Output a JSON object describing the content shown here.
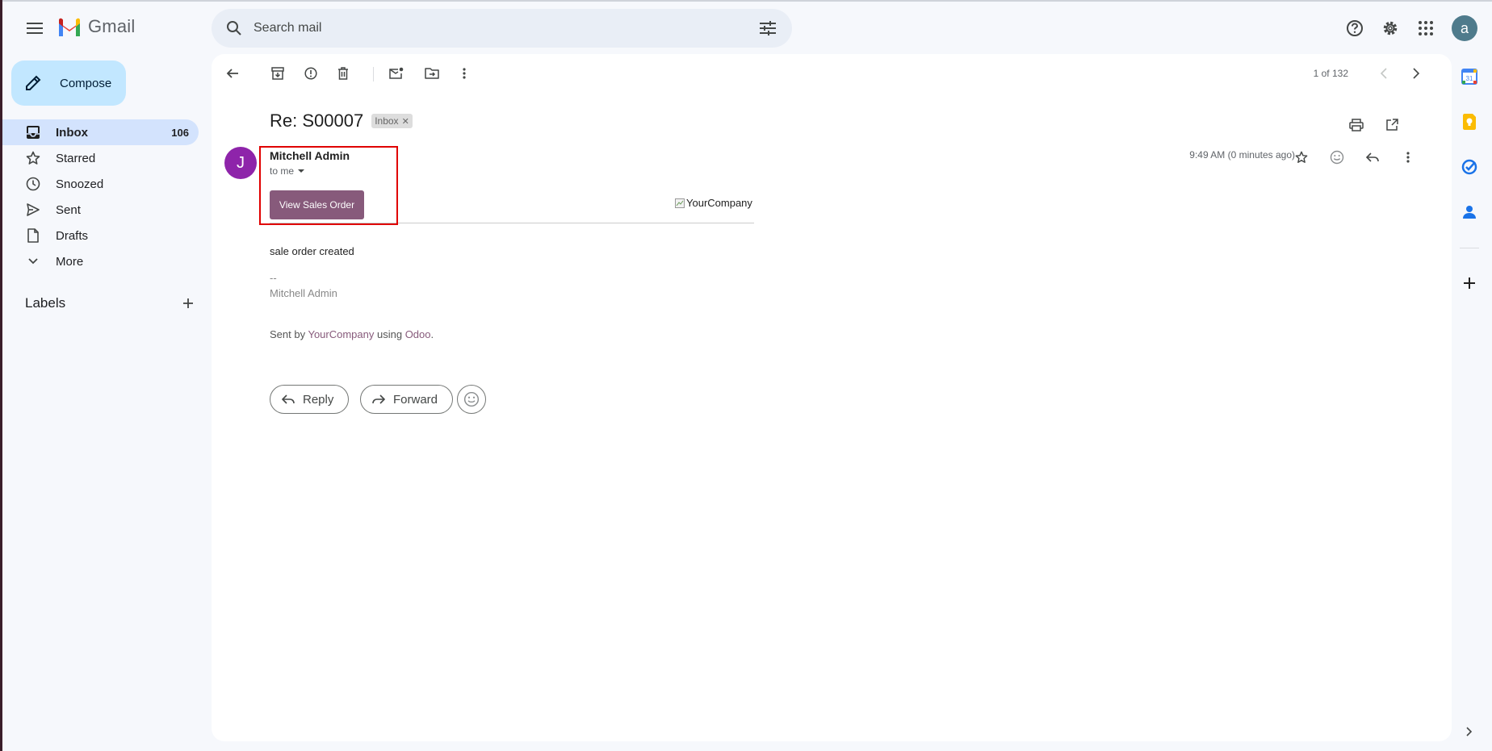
{
  "app": {
    "name": "Gmail"
  },
  "search": {
    "placeholder": "Search mail"
  },
  "account": {
    "initial": "a"
  },
  "compose": {
    "label": "Compose"
  },
  "nav": {
    "items": [
      {
        "label": "Inbox",
        "count": "106",
        "icon": "inbox-icon"
      },
      {
        "label": "Starred",
        "count": "",
        "icon": "star-icon"
      },
      {
        "label": "Snoozed",
        "count": "",
        "icon": "clock-icon"
      },
      {
        "label": "Sent",
        "count": "",
        "icon": "send-icon"
      },
      {
        "label": "Drafts",
        "count": "",
        "icon": "draft-icon"
      },
      {
        "label": "More",
        "count": "",
        "icon": "chevron-down-icon"
      }
    ],
    "labels_heading": "Labels"
  },
  "toolbar": {
    "pager": "1 of 132"
  },
  "email": {
    "subject": "Re: S00007",
    "tag": "Inbox",
    "sender_initial": "J",
    "sender_name": "Mitchell Admin",
    "to": "to me",
    "time": "9:49 AM (0 minutes ago)",
    "view_button": "View Sales Order",
    "company_logo_alt": "YourCompany",
    "body": "sale order created",
    "sig_dash": "--",
    "sig_name": "Mitchell Admin",
    "sent_by_prefix": "Sent by ",
    "sent_by_company": "YourCompany",
    "sent_by_using": " using ",
    "sent_by_odoo": "Odoo",
    "sent_by_suffix": "."
  },
  "actions": {
    "reply": "Reply",
    "forward": "Forward"
  },
  "colors": {
    "compose_bg": "#c2e7ff",
    "active_nav": "#d3e3fd",
    "odoo_purple": "#875a7b",
    "avatar_purple": "#8e24aa",
    "highlight": "#e00000"
  }
}
